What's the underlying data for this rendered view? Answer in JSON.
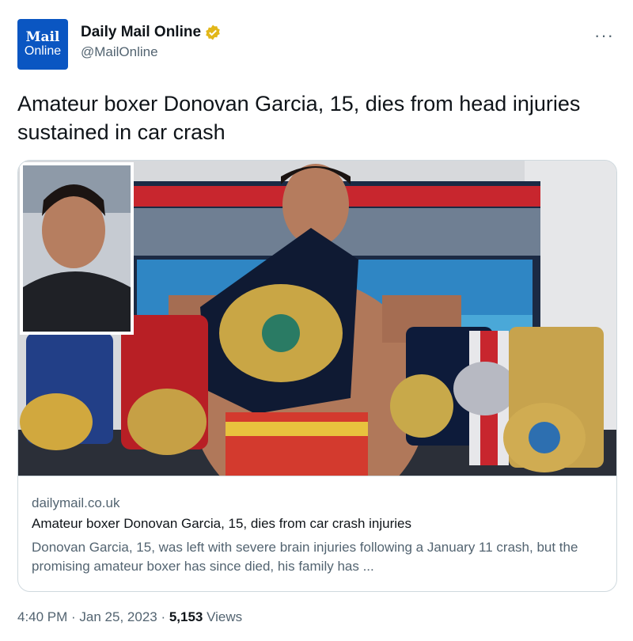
{
  "account": {
    "logo_line1": "Mail",
    "logo_line2": "Online",
    "display_name": "Daily Mail Online",
    "handle": "@MailOnline",
    "verified_icon": "verified-badge-icon",
    "more_icon": "more-icon",
    "more_label": "···"
  },
  "tweet": {
    "text": "Amateur boxer Donovan Garcia, 15, dies from head injuries sustained in car crash"
  },
  "card": {
    "domain": "dailymail.co.uk",
    "title": "Amateur boxer Donovan Garcia, 15, dies from car crash injuries",
    "description": "Donovan Garcia, 15, was left with severe brain injuries following a January 11 crash, but the promising amateur boxer has since died, his family has ..."
  },
  "meta": {
    "time": "4:40 PM",
    "sep1": " · ",
    "date": "Jan 25, 2023",
    "sep2": " · ",
    "views_count": "5,153",
    "views_label": " Views"
  },
  "colors": {
    "brand_blue": "#0a56c2",
    "verified_gold": "#e2b719",
    "secondary_text": "#536471"
  }
}
